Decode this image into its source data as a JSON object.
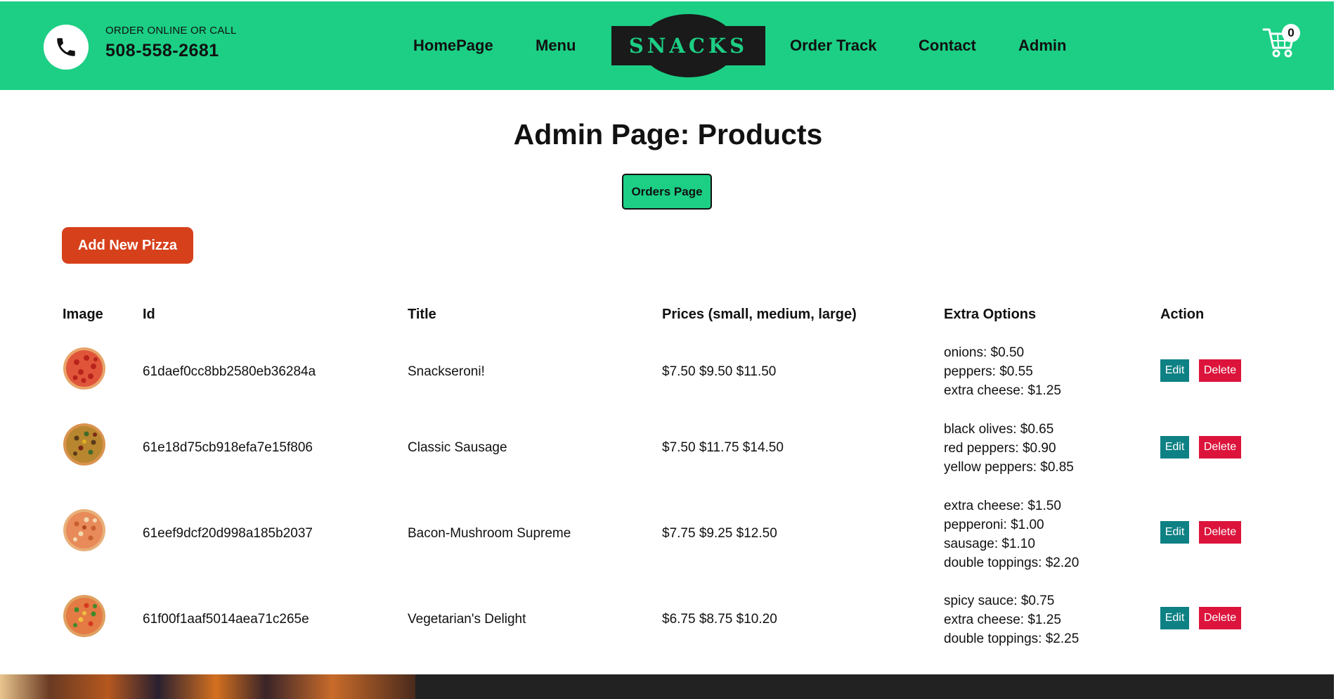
{
  "header": {
    "call_label": "ORDER ONLINE OR CALL",
    "phone": "508-558-2681",
    "nav": [
      "HomePage",
      "Menu",
      "Order Track",
      "Contact",
      "Admin"
    ],
    "logo_text": "SNACKS",
    "cart_count": "0",
    "accent_color": "#1ccf85"
  },
  "main": {
    "title": "Admin Page: Products",
    "orders_button": "Orders Page",
    "add_button": "Add New Pizza",
    "columns": [
      "Image",
      "Id",
      "Title",
      "Prices (small, medium, large)",
      "Extra Options",
      "Action"
    ],
    "edit_label": "Edit",
    "delete_label": "Delete",
    "rows": [
      {
        "id": "61daef0cc8bb2580eb36284a",
        "title": "Snackseroni!",
        "prices": "$7.50 $9.50 $11.50",
        "options": [
          "onions: $0.50",
          "peppers: $0.55",
          "extra cheese: $1.25"
        ]
      },
      {
        "id": "61e18d75cb918efa7e15f806",
        "title": "Classic Sausage",
        "prices": "$7.50 $11.75 $14.50",
        "options": [
          "black olives: $0.65",
          "red peppers: $0.90",
          "yellow peppers: $0.85"
        ]
      },
      {
        "id": "61eef9dcf20d998a185b2037",
        "title": "Bacon-Mushroom Supreme",
        "prices": "$7.75 $9.25 $12.50",
        "options": [
          "extra cheese: $1.50",
          "pepperoni: $1.00",
          "sausage: $1.10",
          "double toppings: $2.20"
        ]
      },
      {
        "id": "61f00f1aaf5014aea71c265e",
        "title": "Vegetarian's Delight",
        "prices": "$6.75 $8.75 $10.20",
        "options": [
          "spicy sauce: $0.75",
          "extra cheese: $1.25",
          "double toppings: $2.25"
        ]
      }
    ]
  }
}
